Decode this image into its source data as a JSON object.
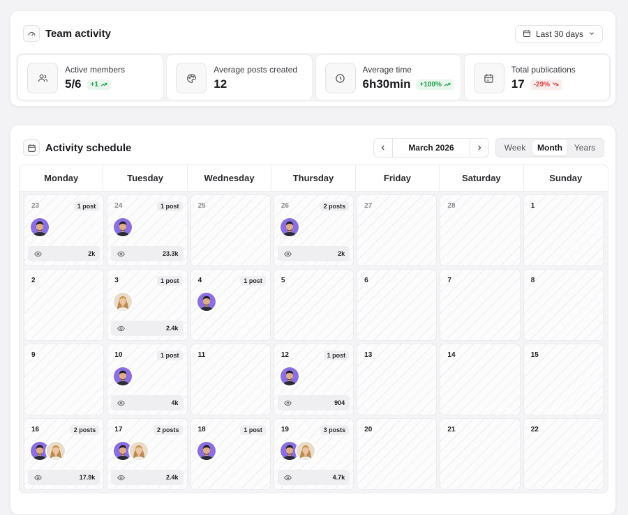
{
  "team": {
    "title": "Team activity",
    "range_label": "Last 30 days",
    "stats": [
      {
        "icon": "users-icon",
        "label": "Active members",
        "value": "5/6",
        "delta": "+1",
        "trend": "up"
      },
      {
        "icon": "palette-icon",
        "label": "Average posts created",
        "value": "12",
        "delta": "",
        "trend": ""
      },
      {
        "icon": "clock-icon",
        "label": "Average time",
        "value": "6h30min",
        "delta": "+100%",
        "trend": "up"
      },
      {
        "icon": "calendar-icon",
        "label": "Total publications",
        "value": "17",
        "delta": "-29%",
        "trend": "down"
      }
    ]
  },
  "schedule": {
    "title": "Activity schedule",
    "month_label": "March 2026",
    "views": [
      "Week",
      "Month",
      "Years"
    ],
    "active_view": "Month",
    "weekdays": [
      "Monday",
      "Tuesday",
      "Wednesday",
      "Thursday",
      "Friday",
      "Saturday",
      "Sunday"
    ],
    "days": [
      {
        "num": "23",
        "muted": true,
        "posts": "1 post",
        "avatars": [
          "m"
        ],
        "views": "2k"
      },
      {
        "num": "24",
        "muted": true,
        "posts": "1 post",
        "avatars": [
          "m"
        ],
        "views": "23.3k"
      },
      {
        "num": "25",
        "muted": true,
        "posts": "",
        "avatars": [],
        "views": ""
      },
      {
        "num": "26",
        "muted": true,
        "posts": "2 posts",
        "avatars": [
          "m"
        ],
        "views": "2k"
      },
      {
        "num": "27",
        "muted": true,
        "posts": "",
        "avatars": [],
        "views": ""
      },
      {
        "num": "28",
        "muted": true,
        "posts": "",
        "avatars": [],
        "views": ""
      },
      {
        "num": "1",
        "muted": false,
        "posts": "",
        "avatars": [],
        "views": ""
      },
      {
        "num": "2",
        "muted": false,
        "posts": "",
        "avatars": [],
        "views": ""
      },
      {
        "num": "3",
        "muted": false,
        "posts": "1 post",
        "avatars": [
          "f"
        ],
        "views": "2.4k"
      },
      {
        "num": "4",
        "muted": false,
        "posts": "1 post",
        "avatars": [
          "m"
        ],
        "views": ""
      },
      {
        "num": "5",
        "muted": false,
        "posts": "",
        "avatars": [],
        "views": ""
      },
      {
        "num": "6",
        "muted": false,
        "posts": "",
        "avatars": [],
        "views": ""
      },
      {
        "num": "7",
        "muted": false,
        "posts": "",
        "avatars": [],
        "views": ""
      },
      {
        "num": "8",
        "muted": false,
        "posts": "",
        "avatars": [],
        "views": ""
      },
      {
        "num": "9",
        "muted": false,
        "posts": "",
        "avatars": [],
        "views": ""
      },
      {
        "num": "10",
        "muted": false,
        "posts": "1 post",
        "avatars": [
          "m"
        ],
        "views": "4k"
      },
      {
        "num": "11",
        "muted": false,
        "posts": "",
        "avatars": [],
        "views": ""
      },
      {
        "num": "12",
        "muted": false,
        "posts": "1 post",
        "avatars": [
          "m"
        ],
        "views": "904"
      },
      {
        "num": "13",
        "muted": false,
        "posts": "",
        "avatars": [],
        "views": ""
      },
      {
        "num": "14",
        "muted": false,
        "posts": "",
        "avatars": [],
        "views": ""
      },
      {
        "num": "15",
        "muted": false,
        "posts": "",
        "avatars": [],
        "views": ""
      },
      {
        "num": "16",
        "muted": false,
        "posts": "2 posts",
        "avatars": [
          "m",
          "f"
        ],
        "views": "17.9k"
      },
      {
        "num": "17",
        "muted": false,
        "posts": "2 posts",
        "avatars": [
          "m",
          "f"
        ],
        "views": "2.4k"
      },
      {
        "num": "18",
        "muted": false,
        "posts": "1 post",
        "avatars": [
          "m"
        ],
        "views": ""
      },
      {
        "num": "19",
        "muted": false,
        "posts": "3 posts",
        "avatars": [
          "m",
          "f"
        ],
        "views": "4.7k"
      },
      {
        "num": "20",
        "muted": false,
        "posts": "",
        "avatars": [],
        "views": ""
      },
      {
        "num": "21",
        "muted": false,
        "posts": "",
        "avatars": [],
        "views": ""
      },
      {
        "num": "22",
        "muted": false,
        "posts": "",
        "avatars": [],
        "views": ""
      }
    ]
  },
  "colors": {
    "accent_purple": "#8b6fe0",
    "positive": "#1f9d48",
    "negative": "#d93a3a"
  }
}
